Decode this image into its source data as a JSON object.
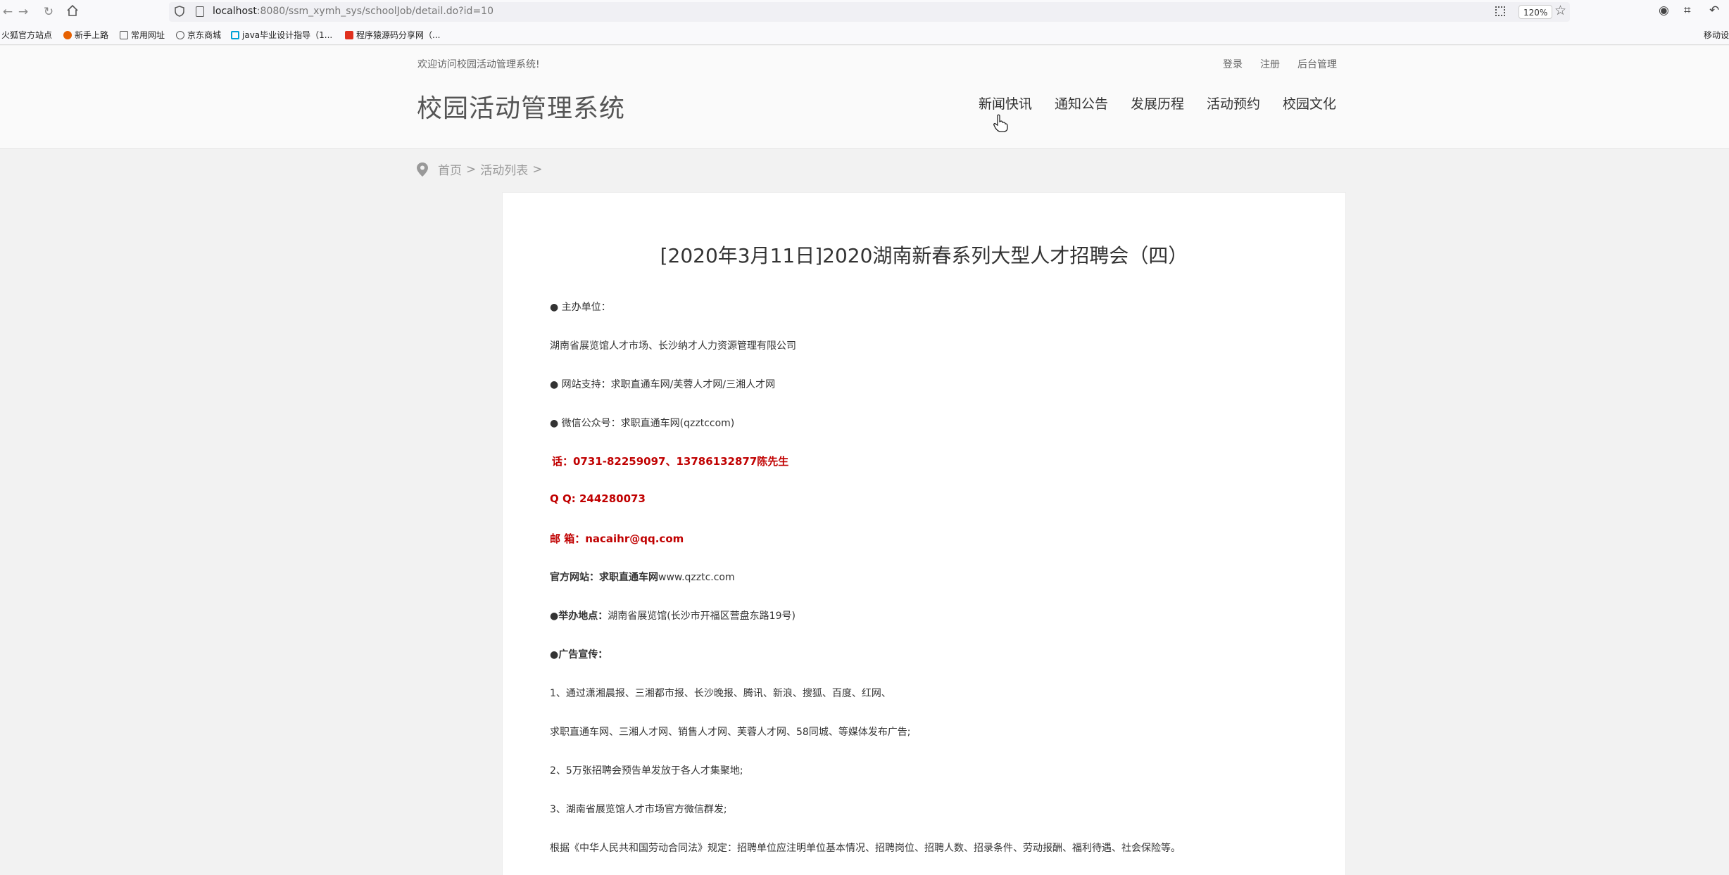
{
  "browser": {
    "url_host": "localhost",
    "url_path": ":8080/ssm_xymh_sys/schoolJob/detail.do?id=10",
    "zoom": "120%",
    "bookmarks": [
      "火狐官方站点",
      "新手上路",
      "常用网址",
      "京东商城",
      "java毕业设计指导（1...",
      "程序猿源码分享网（..."
    ],
    "bookmarks_right": "移动设"
  },
  "site": {
    "welcome": "欢迎访问校园活动管理系统!",
    "top_links": [
      "登录",
      "注册",
      "后台管理"
    ],
    "title": "校园活动管理系统",
    "nav": [
      "新闻快讯",
      "通知公告",
      "发展历程",
      "活动预约",
      "校园文化"
    ]
  },
  "breadcrumb": {
    "home": "首页",
    "sep": ">",
    "list": "活动列表"
  },
  "article": {
    "title": "[2020年3月11日]2020湖南新春系列大型人才招聘会（四）",
    "p1": "● 主办单位：",
    "p2": "湖南省展览馆人才市场、长沙纳才人力资源管理有限公司",
    "p3": "● 网站支持：求职直通车网/芙蓉人才网/三湘人才网",
    "p4": "● 微信公众号：求职直通车网(qzztccom)",
    "p5": "话：0731-82259097、13786132877陈先生",
    "p6": "Q Q: 244280073",
    "p7": "邮  箱：nacaihr@qq.com",
    "p8_label": "官方网站：求职直通车网",
    "p8_value": "www.qzztc.com",
    "p9_label": "●举办地点：",
    "p9_value": "湖南省展览馆(长沙市开福区营盘东路19号)",
    "p10": "●广告宣传：",
    "p11": "1、通过潇湘晨报、三湘都市报、长沙晚报、腾讯、新浪、搜狐、百度、红网、",
    "p12": "求职直通车网、三湘人才网、销售人才网、芙蓉人才网、58同城、等媒体发布广告;",
    "p13": "2、5万张招聘会预告单发放于各人才集聚地;",
    "p14": "3、湖南省展览馆人才市场官方微信群发;",
    "p15": "根据《中华人民共和国劳动合同法》规定：招聘单位应注明单位基本情况、招聘岗位、招聘人数、招录条件、劳动报酬、福利待遇、社会保险等。"
  }
}
